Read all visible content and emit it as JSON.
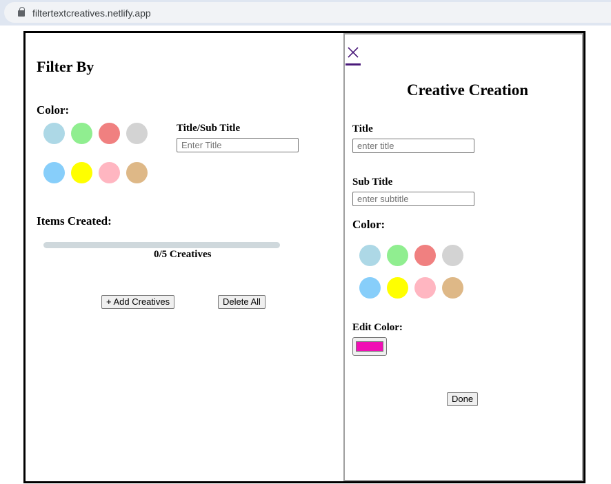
{
  "browser": {
    "url": "filtertextcreatives.netlify.app"
  },
  "filter": {
    "title": "Filter By",
    "color_label": "Color:",
    "swatches": [
      "#add8e6",
      "#90ee90",
      "#f08080",
      "#d3d3d3",
      "#87cefa",
      "#ffff00",
      "#ffb6c1",
      "#deb887"
    ],
    "title_label": "Title/Sub Title",
    "title_placeholder": "Enter Title",
    "title_value": ""
  },
  "items": {
    "title": "Items Created:",
    "progress_fraction": 0,
    "progress_text": "0/5 Creatives",
    "add_button": "+ Add Creatives",
    "delete_button": "Delete All"
  },
  "panel": {
    "title": "Creative Creation",
    "title_label": "Title",
    "title_placeholder": "enter title",
    "subtitle_label": "Sub Title",
    "subtitle_placeholder": "enter subtitle",
    "color_label": "Color:",
    "swatches": [
      "#add8e6",
      "#90ee90",
      "#f08080",
      "#d3d3d3",
      "#87cefa",
      "#ffff00",
      "#ffb6c1",
      "#deb887"
    ],
    "edit_color_label": "Edit Color:",
    "edit_color_value": "#f00fb4",
    "done_button": "Done"
  },
  "icons": {
    "close": "close-icon",
    "lock": "lock-icon"
  }
}
